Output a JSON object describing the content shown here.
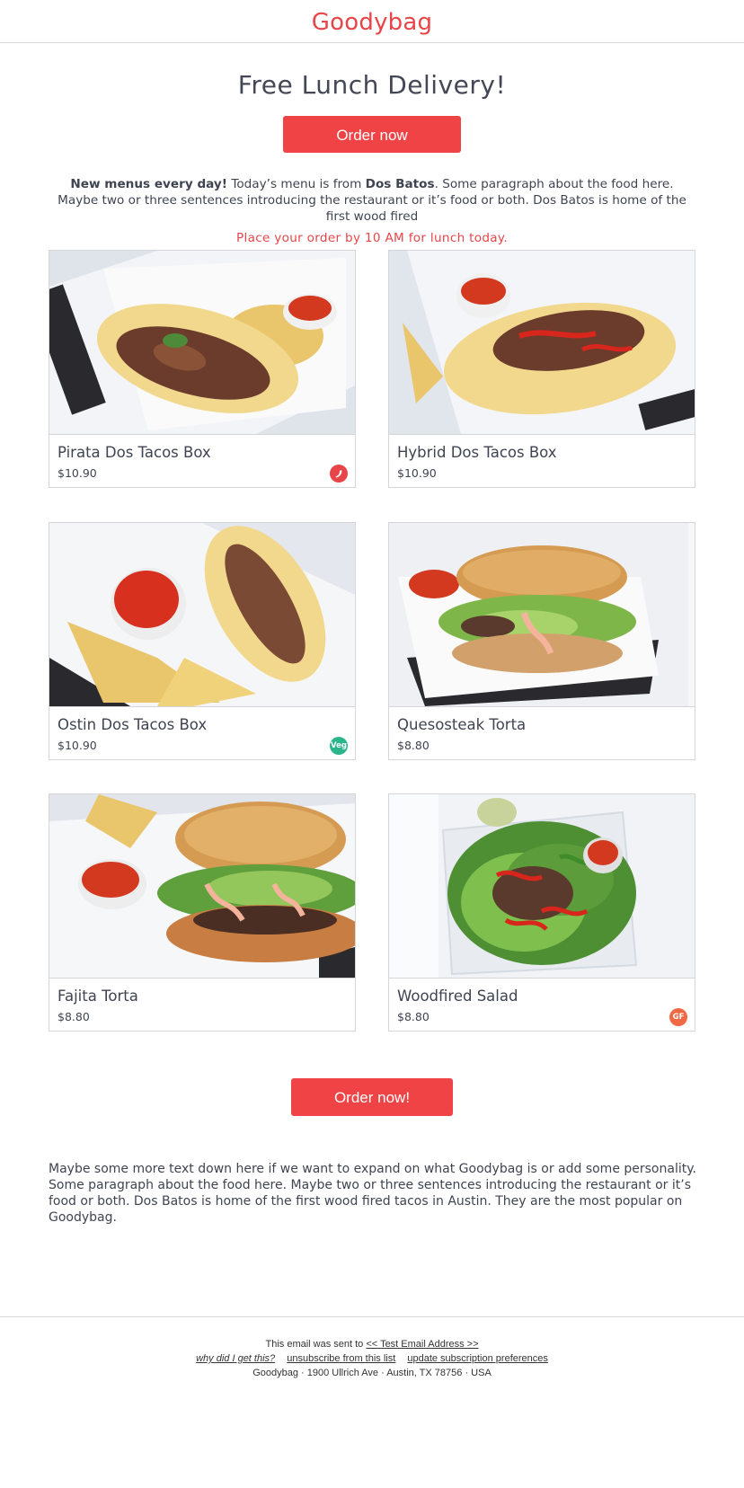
{
  "header": {
    "logo": "Goodybag"
  },
  "hero": {
    "title": "Free Lunch Delivery!",
    "order_button": "Order now"
  },
  "intro": {
    "lead": "New menus every day!",
    "text1": " Today’s menu is from ",
    "restaurant": "Dos Batos",
    "text2": ". Some paragraph about the food here. Maybe two or three sentences introducing the restaurant or it’s food or both. Dos Batos is home of the first wood fired",
    "deadline": "Place your order by 10 AM for lunch today."
  },
  "menu": {
    "items": [
      {
        "name": "Pirata Dos Tacos Box",
        "price": "$10.90",
        "badge": "spicy-icon",
        "badge_label": "",
        "badge_color": "#e84549"
      },
      {
        "name": "Hybrid Dos Tacos Box",
        "price": "$10.90",
        "badge": "",
        "badge_label": "",
        "badge_color": ""
      },
      {
        "name": "Ostin Dos Tacos Box",
        "price": "$10.90",
        "badge": "veg-icon",
        "badge_label": "Veg",
        "badge_color": "#2bb58a"
      },
      {
        "name": "Quesosteak Torta",
        "price": "$8.80",
        "badge": "",
        "badge_label": "",
        "badge_color": ""
      },
      {
        "name": "Fajita Torta",
        "price": "$8.80",
        "badge": "",
        "badge_label": "",
        "badge_color": ""
      },
      {
        "name": "Woodfired Salad",
        "price": "$8.80",
        "badge": "gf-icon",
        "badge_label": "GF",
        "badge_color": "#ef6a44"
      }
    ]
  },
  "cta": {
    "order_button": "Order now!"
  },
  "outro": {
    "text": "Maybe some more text down here if we want to expand on what Goodybag is or add some personality. Some paragraph about the food here. Maybe two or three sentences introducing the restaurant or it’s food or both. Dos Batos is home of the first wood fired tacos in Austin. They are the most popular on Goodybag."
  },
  "footer": {
    "sent_to": "This email was sent to ",
    "email_link": "<< Test Email Address >>",
    "why_link": "why did I get this?",
    "unsubscribe_link": "unsubscribe from this list",
    "preferences_link": "update subscription preferences",
    "address": "Goodybag · 1900 Ullrich Ave · Austin, TX 78756 · USA"
  },
  "colors": {
    "brand": "#e84549",
    "button": "#ef4346",
    "text": "#3f4451"
  }
}
